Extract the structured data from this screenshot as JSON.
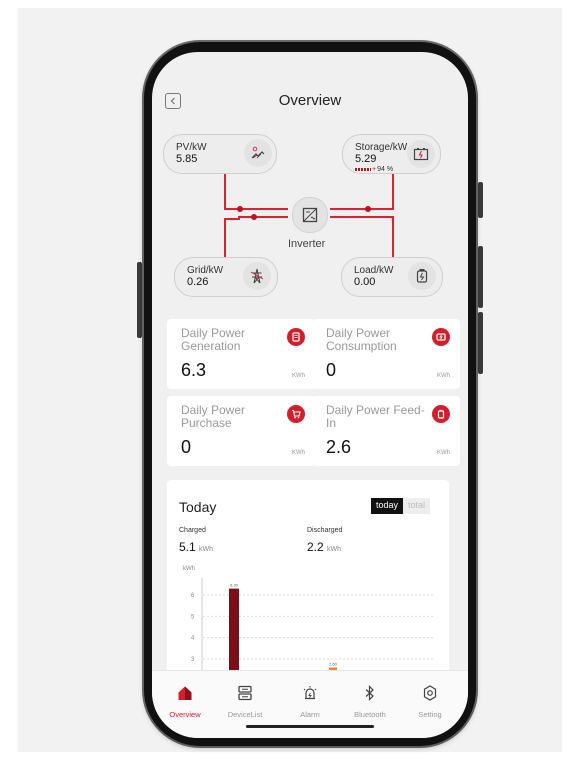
{
  "header": {
    "title": "Overview"
  },
  "flow": {
    "pv": {
      "label": "PV/kW",
      "value": "5.85"
    },
    "storage": {
      "label": "Storage/kW",
      "value": "5.29",
      "percent": "94 %"
    },
    "inverter": {
      "label": "Inverter"
    },
    "grid": {
      "label": "Grid/kW",
      "value": "0.26"
    },
    "load": {
      "label": "Load/kW",
      "value": "0.00"
    },
    "line_color": "#e0202e"
  },
  "cards": [
    {
      "title": "Daily Power Generation",
      "value": "6.3",
      "unit": "KWh",
      "icon": "generation-icon"
    },
    {
      "title": "Daily Power Consumption",
      "value": "0",
      "unit": "KWh",
      "icon": "consumption-icon"
    },
    {
      "title": "Daily Power Purchase",
      "value": "0",
      "unit": "KWh",
      "icon": "cart-icon"
    },
    {
      "title": "Daily Power Feed-In",
      "value": "2.6",
      "unit": "KWh",
      "icon": "battery-feed-icon"
    }
  ],
  "today": {
    "title": "Today",
    "toggle_today": "today",
    "toggle_total": "total",
    "charged_label": "Charged",
    "charged_value": "5.1",
    "charged_unit": "kWh",
    "discharged_label": "Discharged",
    "discharged_value": "2.2",
    "discharged_unit": "kWh"
  },
  "chart_data": {
    "type": "bar",
    "ylabel": "kWh",
    "yticks": [
      "6",
      "5",
      "4",
      "3"
    ],
    "ylim": [
      2.5,
      6.5
    ],
    "series": [
      {
        "values": [
          6.3
        ],
        "color": "#7a0f18",
        "label": "6.30"
      },
      {
        "values": [
          2.6
        ],
        "color": "#e8873a",
        "label": "2.60"
      }
    ]
  },
  "tabs": [
    {
      "label": "Overview",
      "icon": "home-icon",
      "active": true
    },
    {
      "label": "DeviceList",
      "icon": "device-list-icon",
      "active": false
    },
    {
      "label": "Alarm",
      "icon": "alarm-icon",
      "active": false
    },
    {
      "label": "Bluetooth",
      "icon": "bluetooth-icon",
      "active": false
    },
    {
      "label": "Setting",
      "icon": "gear-icon",
      "active": false
    }
  ],
  "colors": {
    "accent": "#d31f2b",
    "bar_charged": "#7a0f18",
    "bar_discharged": "#e8873a"
  }
}
